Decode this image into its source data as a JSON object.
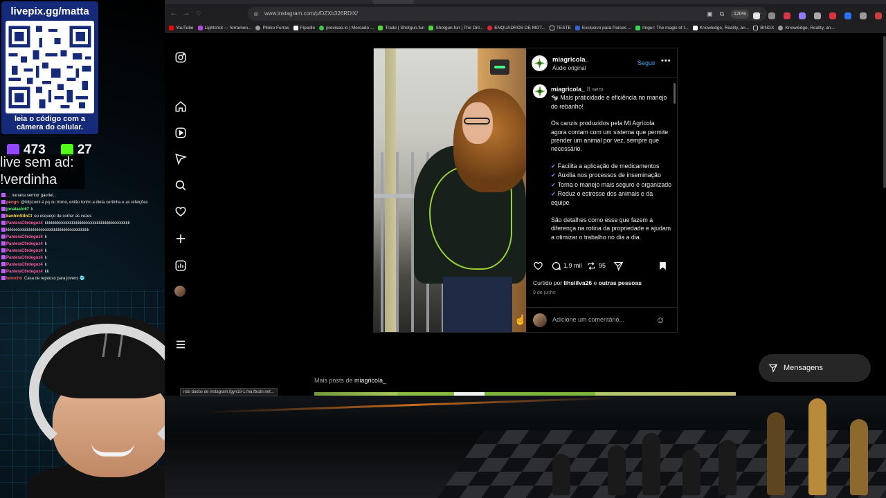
{
  "browser": {
    "url": "www.instagram.com/p/DZXb326RDlX/",
    "zoom": "120%",
    "bookmarks": [
      "YouTube",
      "Lightshot — ferramen...",
      "Plinko Furras",
      "Fipedle",
      "previsao.io | Mercado ...",
      "Trade | Shotgun.fun",
      "Shotgun.fun | The Onl...",
      "ENQUADROS DE MOT...",
      "TESTE",
      "Exclusivo para Países ...",
      "Imgur: The magic of t...",
      "Knowledge, Reality, an...",
      "BINGX",
      "Knowledge, Reality, an..."
    ],
    "status_text": "ndo dados de instagram.fgyn18-1.fna.fbcdn.net..."
  },
  "colors": {
    "accent_blue": "#4aa6f0",
    "twitch": "#9146ff",
    "kick": "#53fc18",
    "qr_panel": "#152a78",
    "check": "#7b8dff"
  },
  "ig_nav": {
    "icons": [
      "instagram-icon",
      "home-icon",
      "reels-icon",
      "explore-icon",
      "search-icon",
      "heart-icon",
      "create-icon",
      "dashboard-icon",
      "profile-avatar",
      "menu-icon"
    ]
  },
  "post": {
    "username": "miagricola_",
    "audio": "Áudio original",
    "follow": "Seguir",
    "more": "•••",
    "caption_time": "8 sem",
    "caption_intro": "🐄 Mais praticidade e eficiência no manejo do rebanho!",
    "caption_para": "Os canzis produzidos pela MI Agrícola agora contam com um sistema que permite prender um animal por vez, sempre que necessário.",
    "checks": [
      "Facilita a aplicação de medicamentos",
      "Auxilia nos processos de inseminação",
      "Torna o manejo mais seguro e organizado",
      "Reduz o estresse dos animais e da equipe"
    ],
    "caption_outro": "São detalhes como esse que fazem a diferença na rotina da propriedade e ajudam a otimizar o trabalho no dia a dia.",
    "comments_count": "1,9 mil",
    "reposts_count": "95",
    "liked_prefix": "Curtido por",
    "liked_user": "lihsiilva26",
    "liked_and": "e",
    "liked_others": "outras pessoas",
    "date": "9 de junho",
    "comment_placeholder": "Adicione um comentário..."
  },
  "more_posts": {
    "prefix": "Mais posts de",
    "user": "miagricola_"
  },
  "messages": {
    "label": "Mensagens"
  },
  "overlay": {
    "qr_title": "livepix.gg/matta",
    "qr_caption": "leia o código com a câmera do celular.",
    "twitch_viewers": "473",
    "kick_viewers": "27",
    "adfree_line1": "live sem ad:",
    "adfree_line2": "!verdinha",
    "chat": [
      {
        "user": "...",
        "color": "#ff6a6a",
        "text": "nanana semtor gaoriel..."
      },
      {
        "user": "pengo",
        "color": "#ff6a6a",
        "text": "@hitpzumi é pq ou troino, então tonho a dieta certinha e as refeições"
      },
      {
        "user": "jonatastc67",
        "color": "#6aff7a",
        "text": "k"
      },
      {
        "user": "banhinStInCt",
        "color": "#ffe14a",
        "text": "eu esqueço de comer as vezes"
      },
      {
        "user": "PanteraC0rdegoz4",
        "color": "#ff5fa2",
        "text": "kkkkkkkkkkkkkkkkkkkkkkkkkkkkkkkkkkkkkkkkk"
      },
      {
        "user": "",
        "color": "#ff5fa2",
        "text": "kkkkkkkkkkkkkkkkkkkkkkkkkkkkkkkkkkkkkkkk"
      },
      {
        "user": "PanteraC0rdegoz4",
        "color": "#ff5fa2",
        "text": "k"
      },
      {
        "user": "PanteraC0rdegoz4",
        "color": "#ff5fa2",
        "text": "k"
      },
      {
        "user": "PanteraC0rdegoz4",
        "color": "#ff5fa2",
        "text": "k"
      },
      {
        "user": "PanteraC0rdegoz4",
        "color": "#ff5fa2",
        "text": "k"
      },
      {
        "user": "PanteraC0rdegoz4",
        "color": "#ff5fa2",
        "text": "k"
      },
      {
        "user": "PanteraC0rdegoz4",
        "color": "#ff5fa2",
        "text": "kk"
      },
      {
        "user": "lenocito",
        "color": "#ff5a5a",
        "text": "Casa de repouso para jovens 🥶"
      }
    ]
  }
}
